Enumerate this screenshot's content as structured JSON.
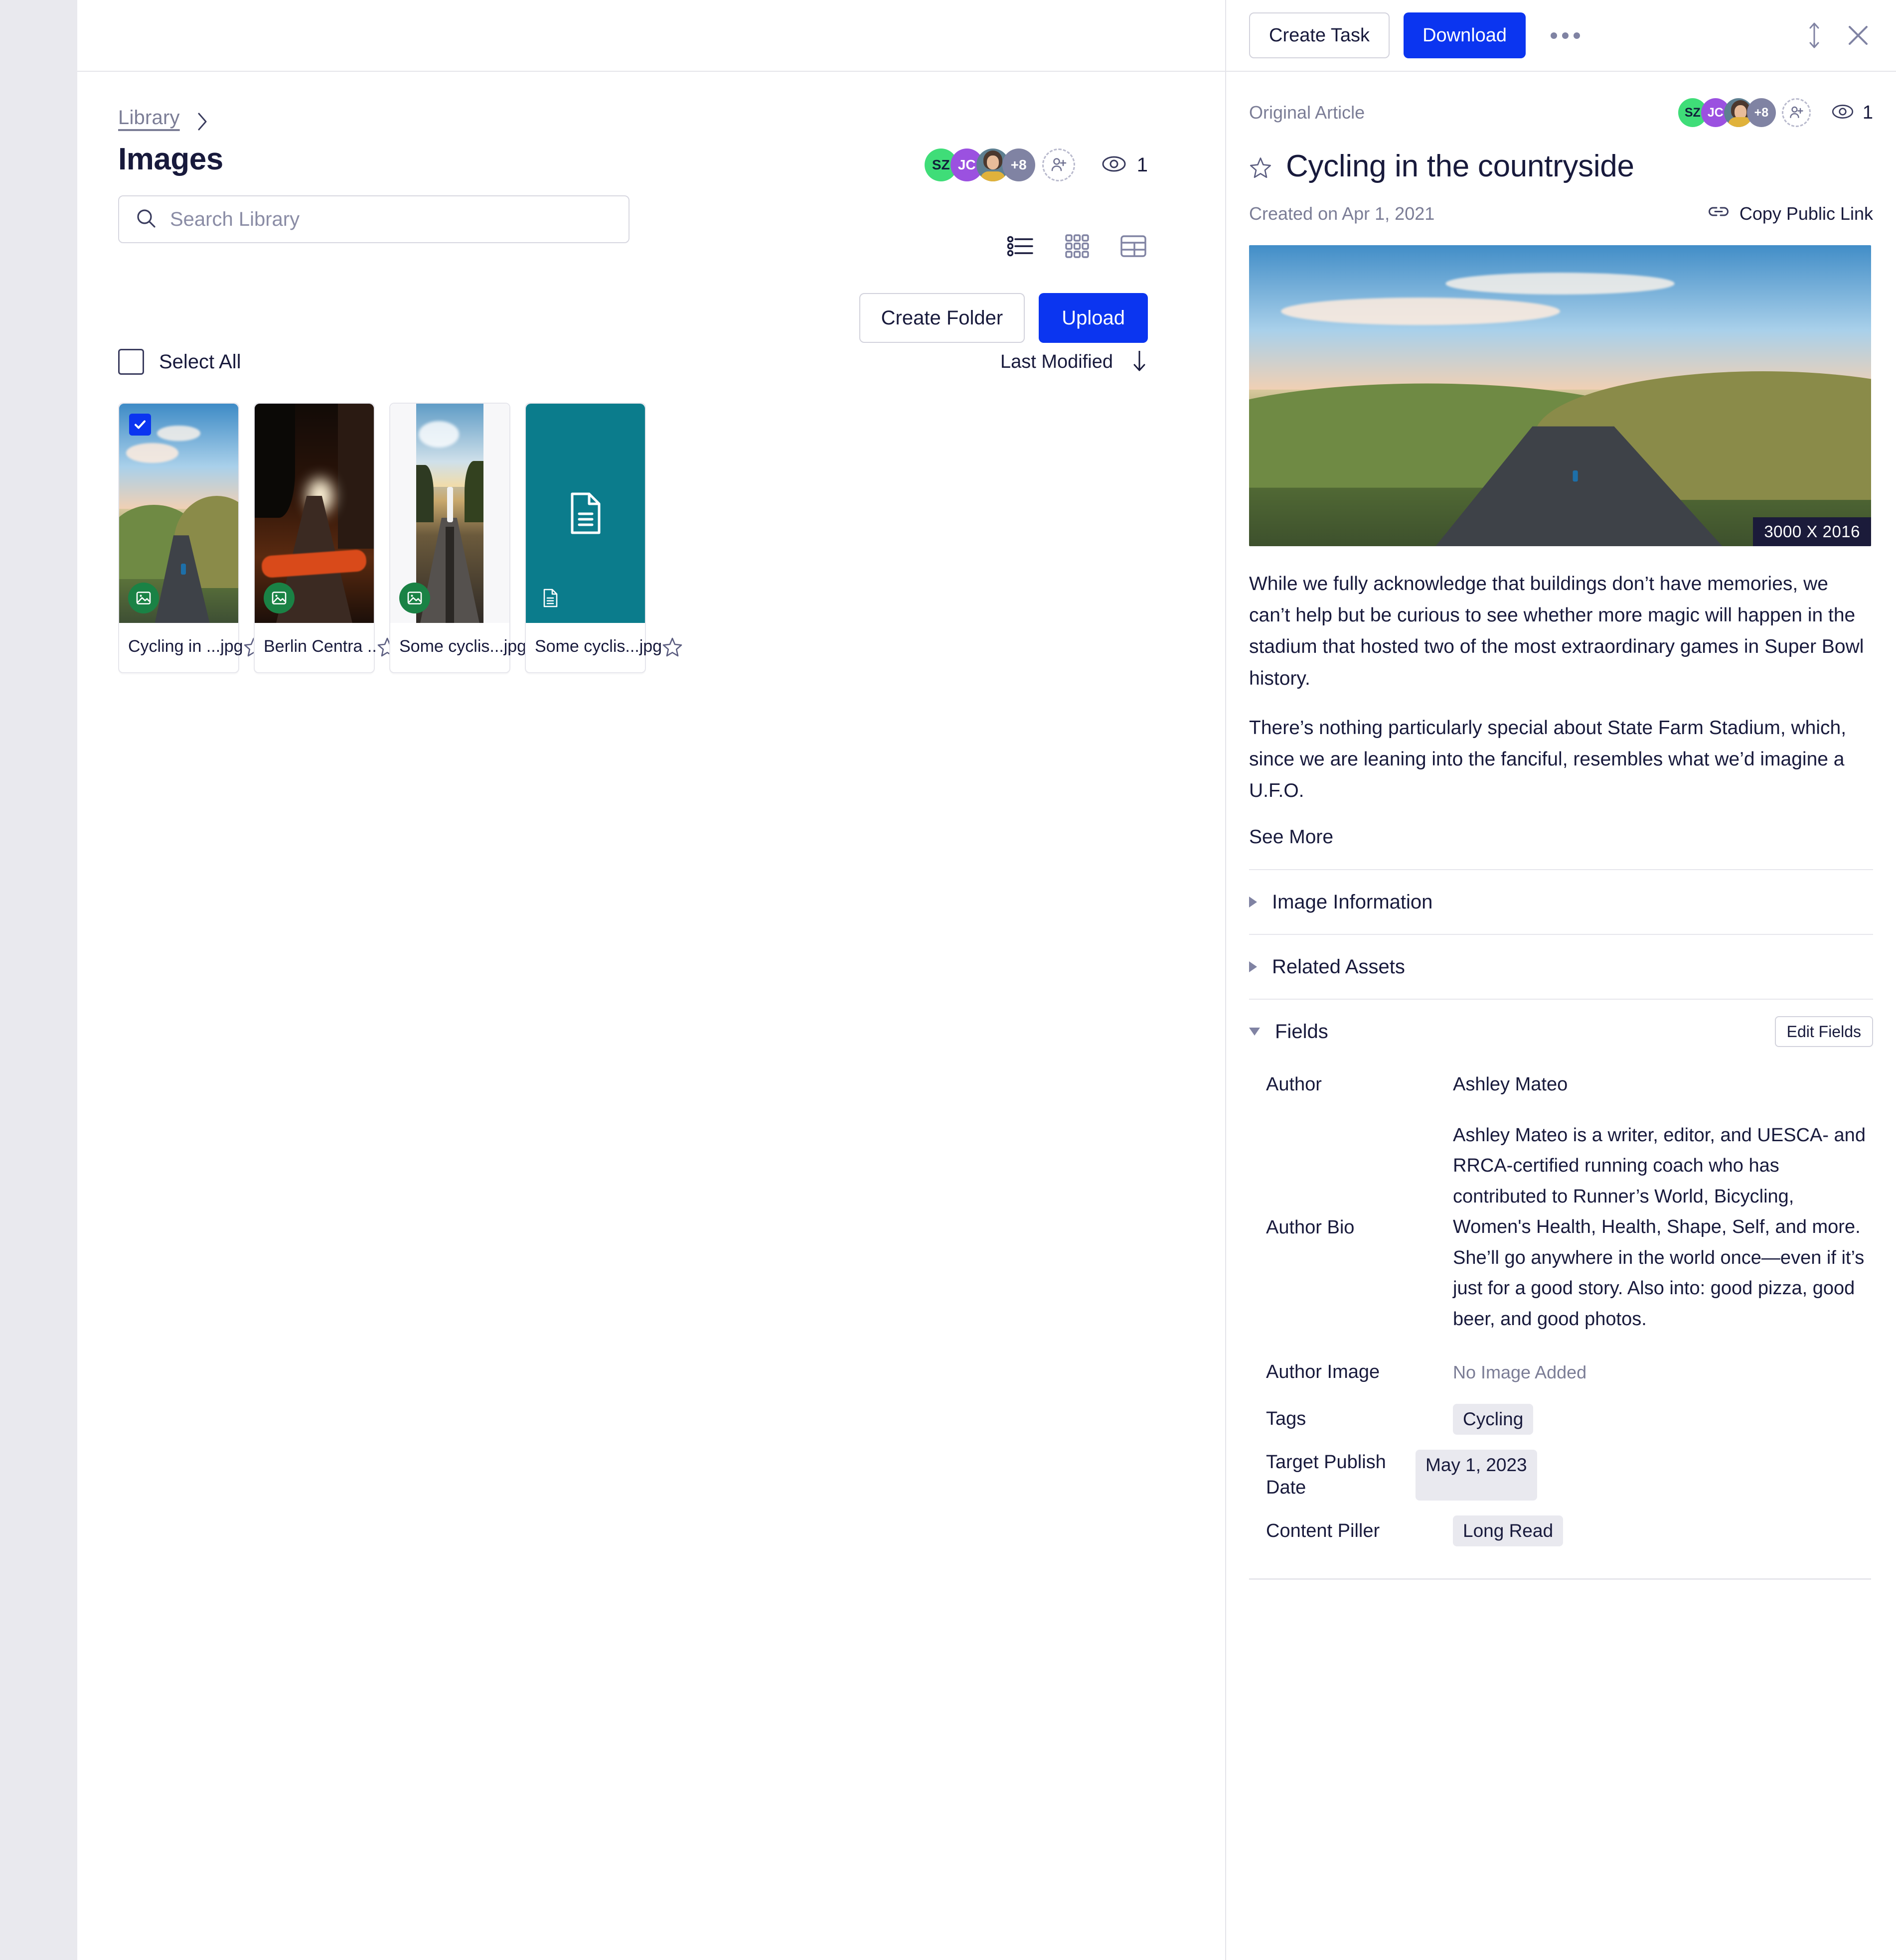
{
  "library": {
    "breadcrumb": {
      "root": "Library"
    },
    "page_title": "Images",
    "search": {
      "placeholder": "Search Library",
      "value": ""
    },
    "collaborators": [
      {
        "initials": "SZ",
        "type": "initials",
        "color": "#3FDD78"
      },
      {
        "initials": "JC",
        "type": "initials",
        "color": "#9B51E0"
      },
      {
        "initials": "",
        "type": "photo",
        "color": "#5E7F91"
      },
      {
        "initials": "+8",
        "type": "overflow",
        "color": "#8083A3"
      }
    ],
    "add_collaborator_label": "add-person",
    "view_count": "1",
    "views": [
      {
        "id": "list",
        "label": "List view",
        "active": true
      },
      {
        "id": "grid",
        "label": "Grid view",
        "active": false
      },
      {
        "id": "table",
        "label": "Table view",
        "active": false
      }
    ],
    "create_folder_label": "Create Folder",
    "upload_label": "Upload",
    "select_all_label": "Select All",
    "select_all_checked": false,
    "sort": {
      "label": "Last Modified",
      "direction": "desc"
    },
    "assets": [
      {
        "name": "Cycling in ...jpg",
        "kind": "image",
        "selected": true,
        "starred": false,
        "art": "country",
        "fit": "cover"
      },
      {
        "name": "Berlin Centra ..",
        "kind": "image",
        "selected": false,
        "starred": false,
        "art": "berlin",
        "fit": "cover"
      },
      {
        "name": "Some cyclis...jpg",
        "kind": "image",
        "selected": false,
        "starred": false,
        "art": "shadow",
        "fit": "contain"
      },
      {
        "name": "Some cyclis...jpg",
        "kind": "document",
        "selected": false,
        "starred": false,
        "art": "doc",
        "fit": "cover"
      }
    ]
  },
  "detail": {
    "create_task_label": "Create Task",
    "download_label": "Download",
    "more_label": "More options",
    "expand_label": "Expand",
    "close_label": "Close",
    "content_type": "Original Article",
    "collaborators": [
      {
        "initials": "SZ",
        "type": "initials",
        "color": "#3FDD78"
      },
      {
        "initials": "JC",
        "type": "initials",
        "color": "#9B51E0"
      },
      {
        "initials": "",
        "type": "photo",
        "color": "#5E7F91"
      },
      {
        "initials": "+8",
        "type": "overflow",
        "color": "#8083A3"
      }
    ],
    "view_count": "1",
    "title": "Cycling in the countryside",
    "starred": false,
    "created_on": "Created on Apr 1, 2021",
    "copy_public_link": "Copy Public Link",
    "hero_dimensions": "3000 X 2016",
    "paragraph_1": "While we fully acknowledge that buildings don’t have memories, we can’t help but be curious to see whether more magic will happen in the stadium that hosted two of the most extraordinary games in Super Bowl history.",
    "paragraph_2": "There’s nothing particularly special about State Farm Stadium, which, since we are leaning into the fanciful, resembles what we’d imagine a U.F.O.",
    "see_more_label": "See More",
    "sections": [
      {
        "id": "image-information",
        "title": "Image Information",
        "expanded": false
      },
      {
        "id": "related-assets",
        "title": "Related Assets",
        "expanded": false
      },
      {
        "id": "fields",
        "title": "Fields",
        "expanded": true
      }
    ],
    "edit_fields_label": "Edit Fields",
    "fields": [
      {
        "key": "Author",
        "value": "Ashley Mateo",
        "style": "plain"
      },
      {
        "key": "Author Bio",
        "value": "Ashley Mateo is a writer, editor, and UESCA- and RRCA-certified running coach who has contributed to Runner’s World, Bicycling, Women's Health, Health, Shape, Self, and more. She’ll go anywhere in the world once—even if it’s just for a good story. Also into: good pizza, good beer, and good photos.",
        "style": "plain"
      },
      {
        "key": "Author Image",
        "value": "No Image Added",
        "style": "muted"
      },
      {
        "key": "Tags",
        "value": "Cycling",
        "style": "chip"
      },
      {
        "key": "Target Publish Date",
        "value": "May 1, 2023",
        "style": "chip"
      },
      {
        "key": "Content Piller",
        "value": "Long Read",
        "style": "chip"
      }
    ]
  },
  "colors": {
    "primary_blue": "#0B35F0",
    "text_dark": "#181A3C",
    "text_muted": "#7B7D96",
    "rail_gray": "#E9E9EE",
    "chip_bg": "#E9E9EF",
    "image_badge_green": "#1A8245",
    "doc_badge_teal": "#0B7C8C"
  }
}
